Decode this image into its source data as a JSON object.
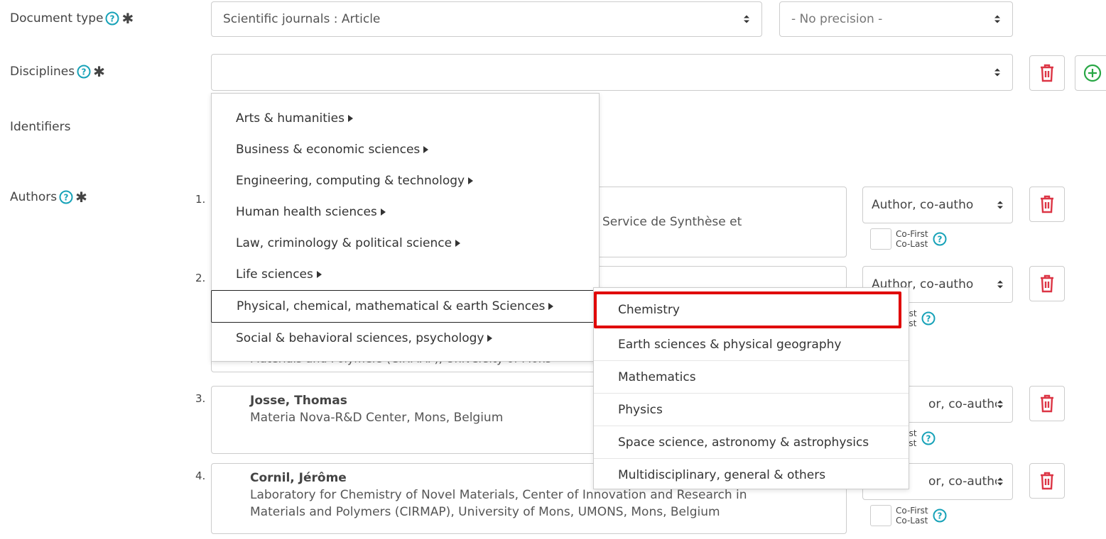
{
  "form": {
    "document_type": {
      "label": "Document type",
      "value": "Scientific journals : Article",
      "precision": "- No precision -"
    },
    "disciplines": {
      "label": "Disciplines",
      "value": ""
    },
    "identifiers": {
      "label": "Identifiers"
    },
    "authors": {
      "label": "Authors",
      "list": [
        {
          "num": "1.",
          "name": "",
          "affiliation": "Service de Synthèse et",
          "role": "Author, co-autho",
          "cofirst": "Co-First",
          "colast": "Co-Last"
        },
        {
          "num": "2.",
          "name": "",
          "affiliation": "Materials and Polymers (CIRMAP), University of Mons",
          "role": "Author, co-autho",
          "cofirst": "-First",
          "colast": "-Last"
        },
        {
          "num": "3.",
          "name": "Josse, Thomas",
          "affiliation": "Materia Nova-R&D Center, Mons, Belgium",
          "role": "or, co-autho",
          "cofirst": "-First",
          "colast": "-Last"
        },
        {
          "num": "4.",
          "name": "Cornil, Jérôme",
          "affiliation_line1": "Laboratory for Chemistry of Novel Materials, Center of Innovation and Research in",
          "affiliation_line2": "Materials and Polymers (CIRMAP), University of Mons, UMONS, Mons, Belgium",
          "role": "or, co-autho",
          "cofirst": "Co-First",
          "colast": "Co-Last"
        }
      ]
    }
  },
  "discipline_menu": {
    "items": [
      "Arts & humanities",
      "Business & economic sciences",
      "Engineering, computing & technology",
      "Human health sciences",
      "Law, criminology & political science",
      "Life sciences",
      "Physical, chemical, mathematical & earth Sciences",
      "Social & behavioral sciences, psychology"
    ],
    "active_index": 6
  },
  "discipline_submenu": {
    "items": [
      "Chemistry",
      "Earth sciences & physical geography",
      "Mathematics",
      "Physics",
      "Space science, astronomy & astrophysics",
      "Multidisciplinary, general & others"
    ],
    "highlighted_index": 0
  },
  "colors": {
    "help": "#17a2b8",
    "delete": "#dc3545",
    "add": "#28a745",
    "highlight": "#e00000"
  },
  "icons": {
    "help": "question-circle-icon",
    "required": "asterisk-icon",
    "caret": "sort-caret-icon",
    "delete": "trash-icon",
    "add": "plus-circle-icon",
    "submenu": "caret-right-icon"
  }
}
